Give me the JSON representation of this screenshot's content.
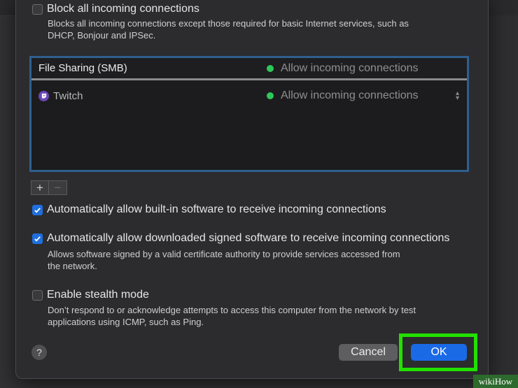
{
  "block_all": {
    "label": "Block all incoming connections",
    "checked": false,
    "description_line1": "Blocks all incoming connections except those required for basic Internet services, such as",
    "description_line2": "DHCP, Bonjour and IPSec."
  },
  "app_list": {
    "rows": [
      {
        "name": "File Sharing (SMB)",
        "status": "Allow incoming connections",
        "status_color": "#2ec85a"
      },
      {
        "name": "Twitch",
        "status": "Allow incoming connections",
        "status_color": "#2ec85a",
        "icon": "twitch-icon"
      }
    ],
    "add_label": "+",
    "remove_label": "−"
  },
  "auto_builtin": {
    "label": "Automatically allow built-in software to receive incoming connections",
    "checked": true
  },
  "auto_signed": {
    "label": "Automatically allow downloaded signed software to receive incoming connections",
    "checked": true,
    "description_line1": "Allows software signed by a valid certificate authority to provide services accessed from",
    "description_line2": "the network."
  },
  "stealth": {
    "label": "Enable stealth mode",
    "checked": false,
    "description_line1": "Don’t respond to or acknowledge attempts to access this computer from the network by test",
    "description_line2": "applications using ICMP, such as Ping."
  },
  "footer": {
    "help_label": "?",
    "cancel_label": "Cancel",
    "ok_label": "OK",
    "highlight_color": "#22e000"
  },
  "watermark": {
    "text": "wikiHow"
  },
  "colors": {
    "accent": "#1a6ae6",
    "list_border": "#2f5f8f"
  }
}
